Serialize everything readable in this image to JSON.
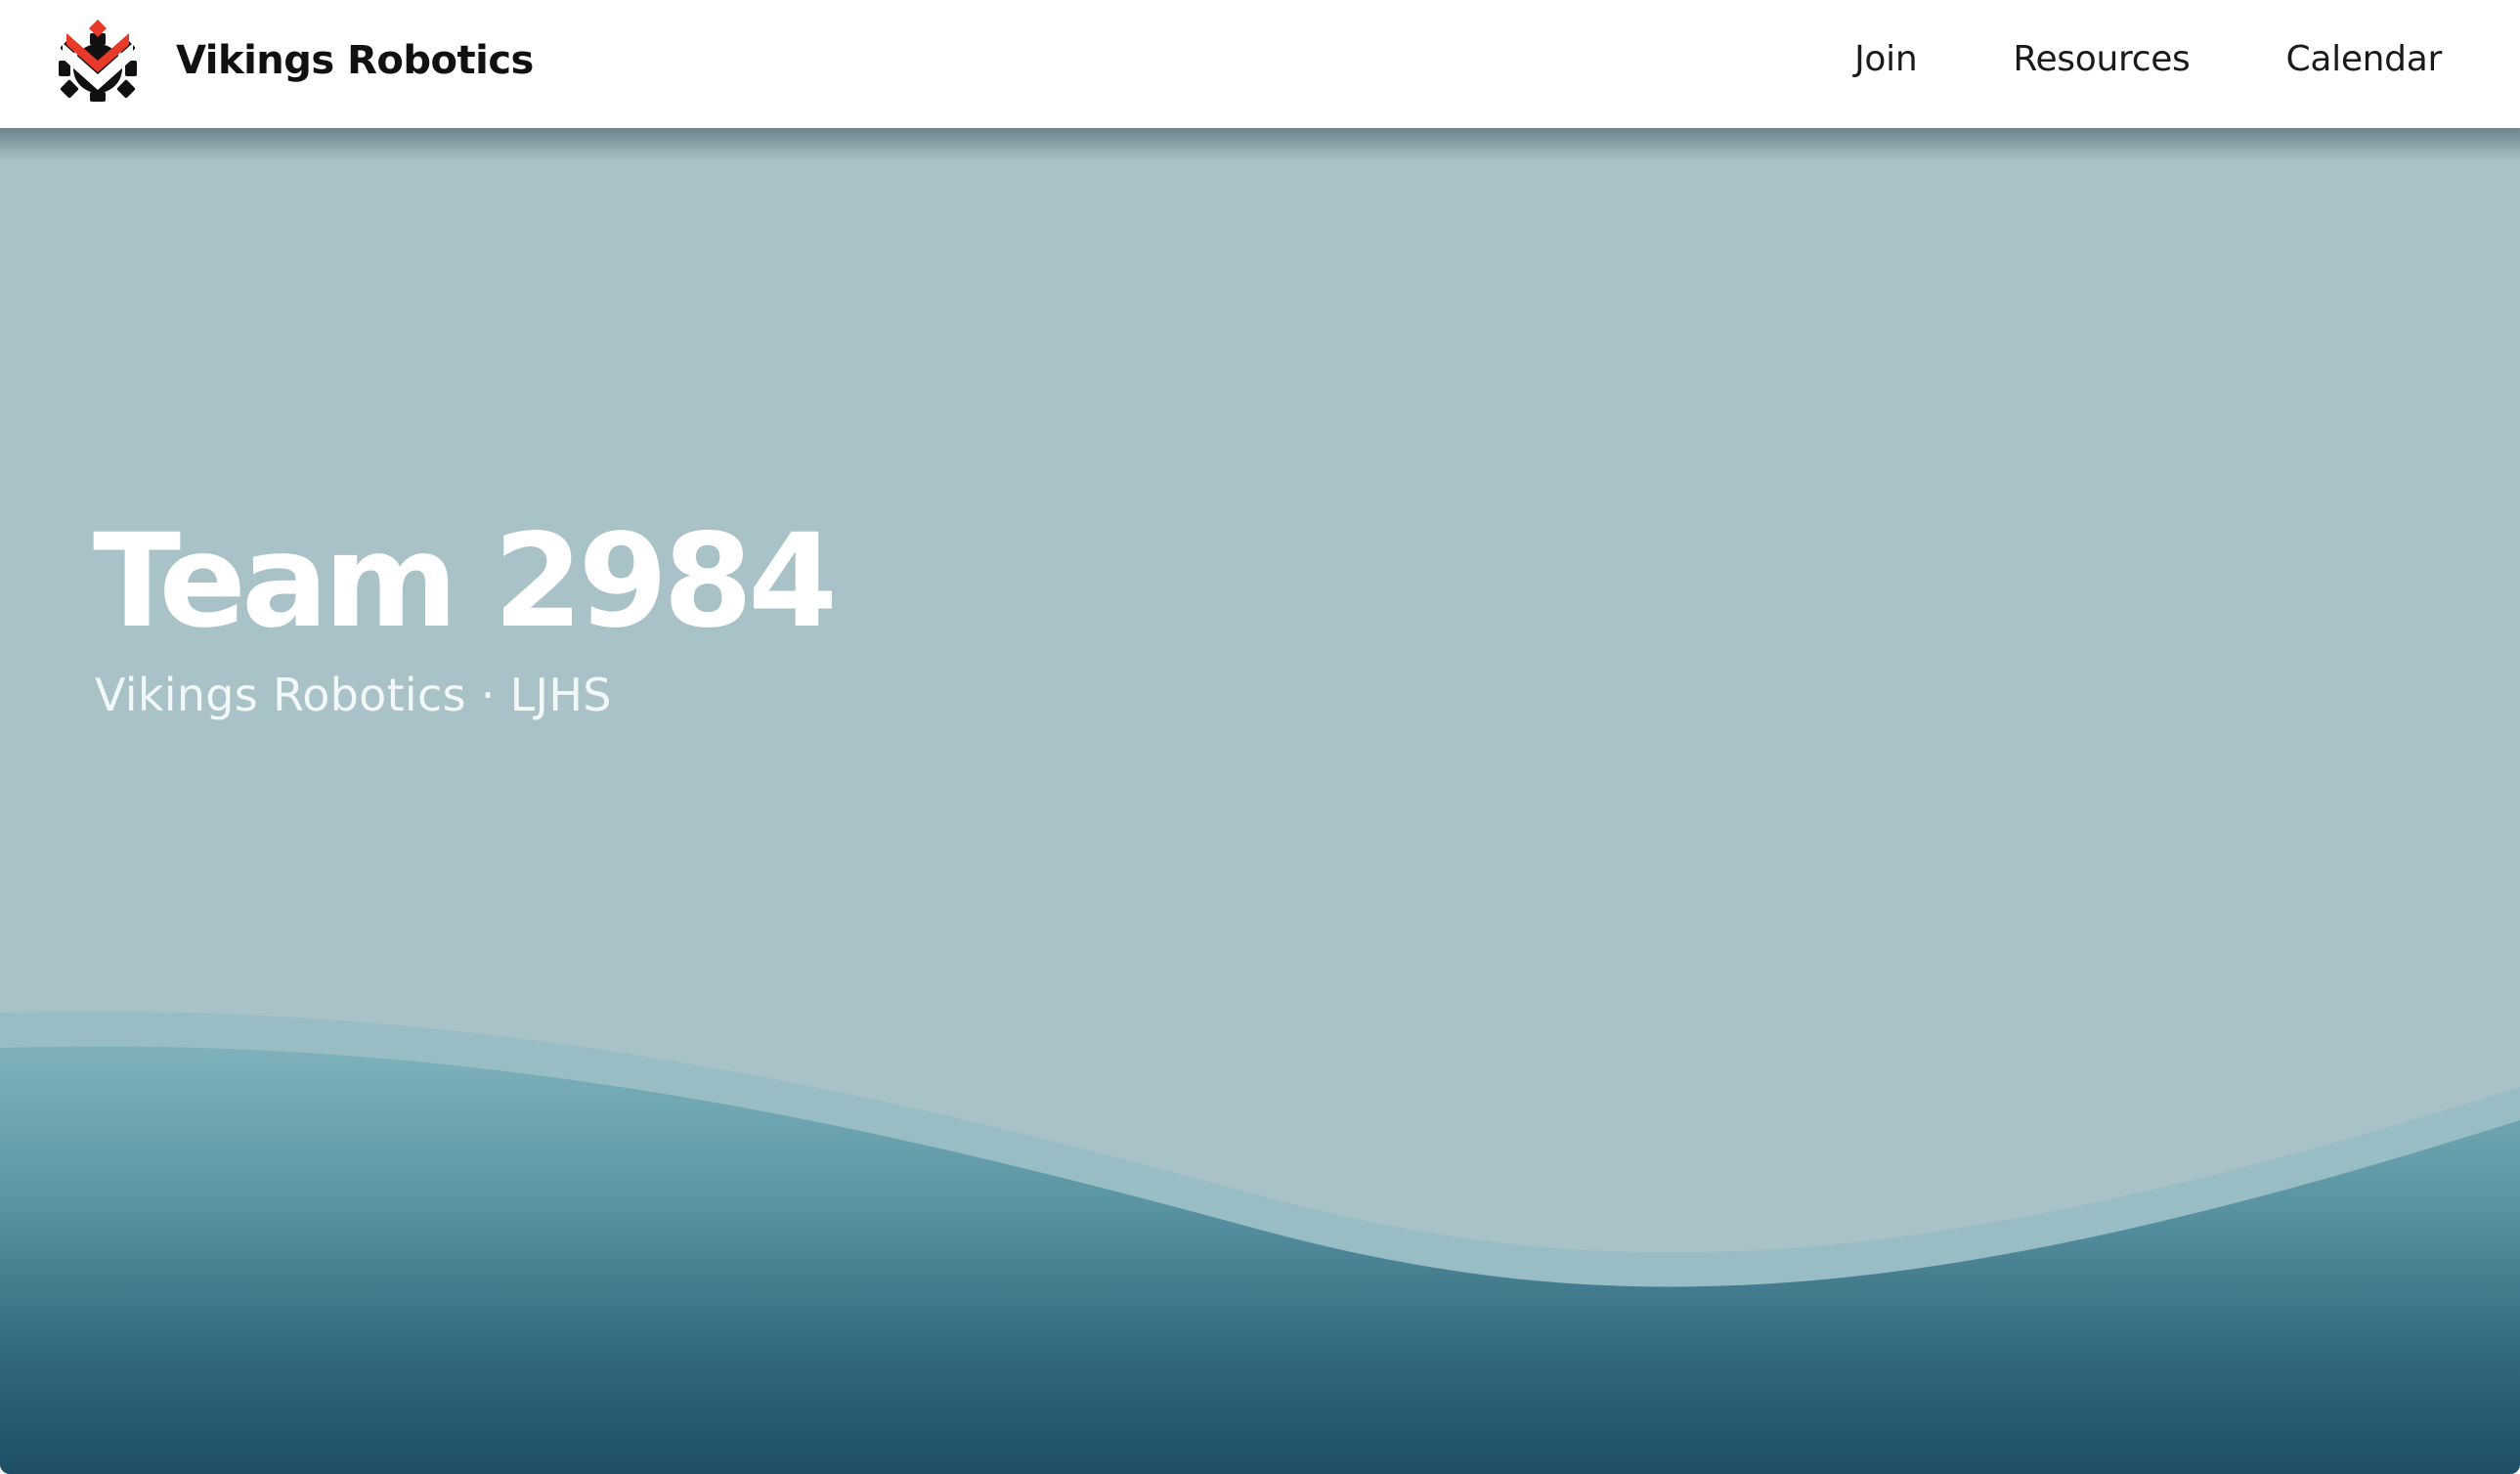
{
  "header": {
    "brand_name": "Vikings Robotics",
    "logo_icon": "vikings-gear-heart-logo",
    "nav": [
      {
        "label": "Join"
      },
      {
        "label": "Resources"
      },
      {
        "label": "Calendar"
      }
    ]
  },
  "hero": {
    "title": "Team 2984",
    "subtitle": "Vikings Robotics · LJHS"
  },
  "colors": {
    "header_background": "#ffffff",
    "brand_text": "#111111",
    "logo_accent": "#e8392b",
    "logo_dark": "#111111",
    "hero_background": "#a8c2c7",
    "wave_top": "#7fb0b9",
    "wave_bottom": "#1d4e66",
    "hero_text": "#ffffff"
  }
}
